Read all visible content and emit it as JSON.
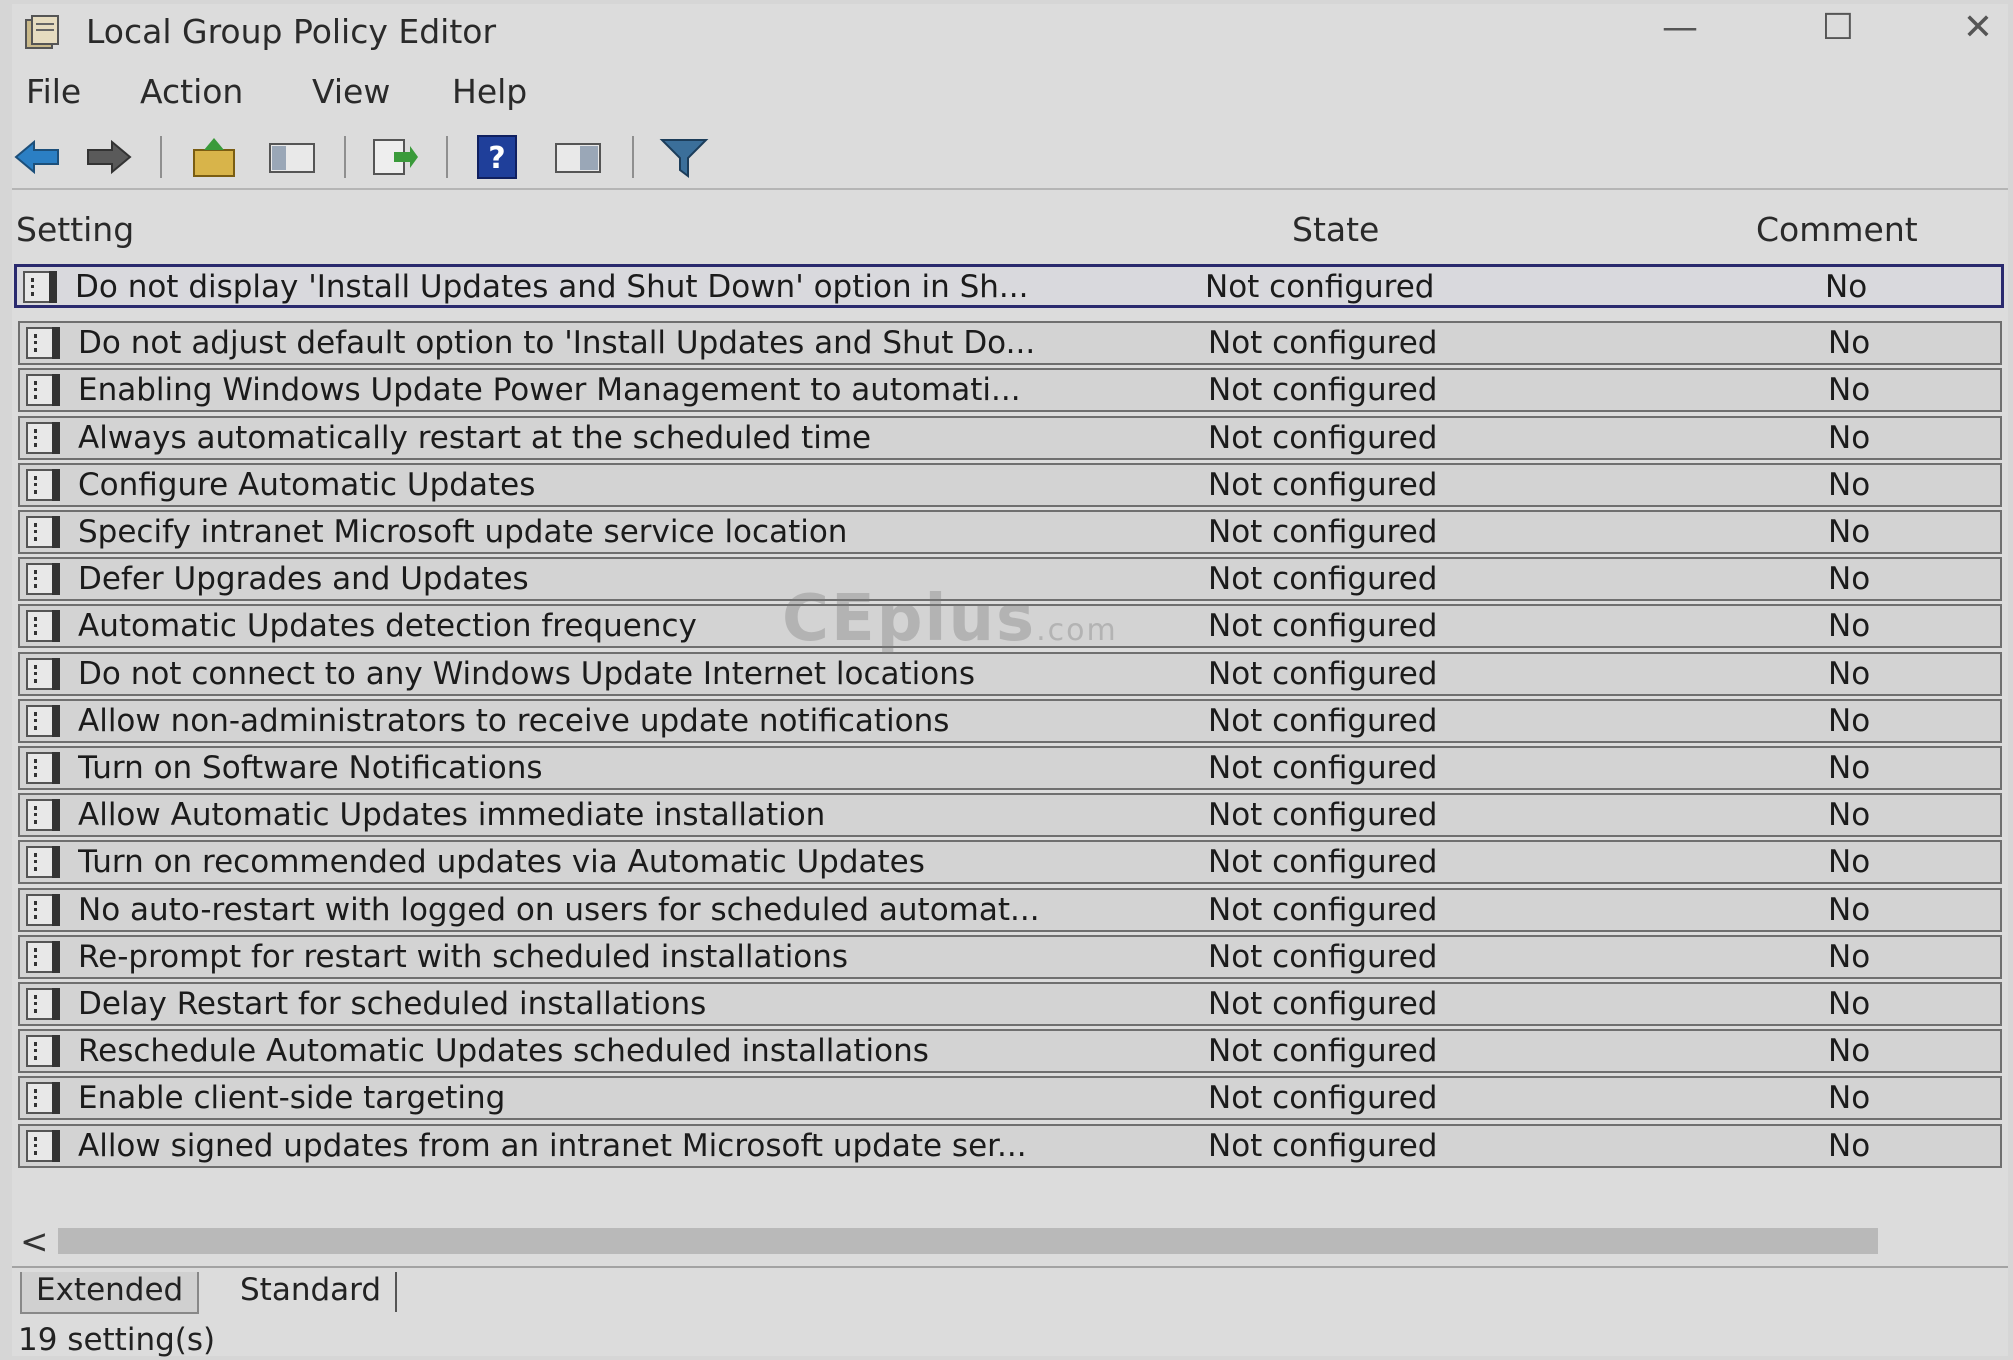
{
  "window": {
    "title": "Local Group Policy Editor",
    "controls": {
      "minimize": "—",
      "maximize": "☐",
      "close": "✕"
    }
  },
  "menu": [
    "File",
    "Action",
    "View",
    "Help"
  ],
  "toolbar": {
    "icons": [
      "back-arrow-icon",
      "forward-arrow-icon",
      "up-folder-icon",
      "show-hide-tree-icon",
      "export-list-icon",
      "help-icon",
      "extended-view-icon",
      "filter-icon"
    ]
  },
  "columns": {
    "setting": "Setting",
    "state": "State",
    "comment": "Comment"
  },
  "rows": [
    {
      "setting": "Do not display 'Install Updates and Shut Down' option in Sh...",
      "state": "Not configured",
      "comment": "No",
      "selected": true
    },
    {
      "setting": "Do not adjust default option to 'Install Updates and Shut Do...",
      "state": "Not configured",
      "comment": "No"
    },
    {
      "setting": "Enabling Windows Update Power Management to automati...",
      "state": "Not configured",
      "comment": "No"
    },
    {
      "setting": "Always automatically restart at the scheduled time",
      "state": "Not configured",
      "comment": "No"
    },
    {
      "setting": "Configure Automatic Updates",
      "state": "Not configured",
      "comment": "No"
    },
    {
      "setting": "Specify intranet Microsoft update service location",
      "state": "Not configured",
      "comment": "No"
    },
    {
      "setting": "Defer Upgrades and Updates",
      "state": "Not configured",
      "comment": "No"
    },
    {
      "setting": "Automatic Updates detection frequency",
      "state": "Not configured",
      "comment": "No"
    },
    {
      "setting": "Do not connect to any Windows Update Internet locations",
      "state": "Not configured",
      "comment": "No"
    },
    {
      "setting": "Allow non-administrators to receive update notifications",
      "state": "Not configured",
      "comment": "No"
    },
    {
      "setting": "Turn on Software Notifications",
      "state": "Not configured",
      "comment": "No"
    },
    {
      "setting": "Allow Automatic Updates immediate installation",
      "state": "Not configured",
      "comment": "No"
    },
    {
      "setting": "Turn on recommended updates via Automatic Updates",
      "state": "Not configured",
      "comment": "No"
    },
    {
      "setting": "No auto-restart with logged on users for scheduled automat...",
      "state": "Not configured",
      "comment": "No"
    },
    {
      "setting": "Re-prompt for restart with scheduled installations",
      "state": "Not configured",
      "comment": "No"
    },
    {
      "setting": "Delay Restart for scheduled installations",
      "state": "Not configured",
      "comment": "No"
    },
    {
      "setting": "Reschedule Automatic Updates scheduled installations",
      "state": "Not configured",
      "comment": "No"
    },
    {
      "setting": "Enable client-side targeting",
      "state": "Not configured",
      "comment": "No"
    },
    {
      "setting": "Allow signed updates from an intranet Microsoft update ser...",
      "state": "Not configured",
      "comment": "No"
    }
  ],
  "watermark": {
    "brand": "CEplus",
    "suffix": ".com"
  },
  "scrollbar": {
    "left_arrow": "<"
  },
  "tabs": [
    "Extended",
    "Standard"
  ],
  "status": "19 setting(s)"
}
